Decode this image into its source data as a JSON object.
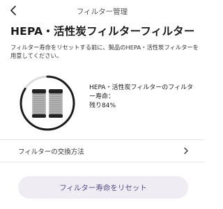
{
  "header": {
    "back_icon": "chevron-left-icon",
    "title": "フィルター管理"
  },
  "page": {
    "heading": "HEPA・活性炭フィルターフィルター",
    "description": "フィルター寿命をリセットする前に、製品のHEPA・活性炭フィルターを用意してください。"
  },
  "filter": {
    "image_icon": "cylindrical-filter-icon",
    "name": "HEPA・活性炭フィルターのフィルター寿命：",
    "status": "残り84%",
    "remaining_percent": 84,
    "ring_color": "#1a1a1a",
    "ring_track_color": "#dcdcdc"
  },
  "exchange": {
    "label": "フィルターの交換方法",
    "chevron_icon": "chevron-right-icon"
  },
  "reset": {
    "label": "フィルター寿命をリセット",
    "accent_color": "#5a4c8a"
  }
}
